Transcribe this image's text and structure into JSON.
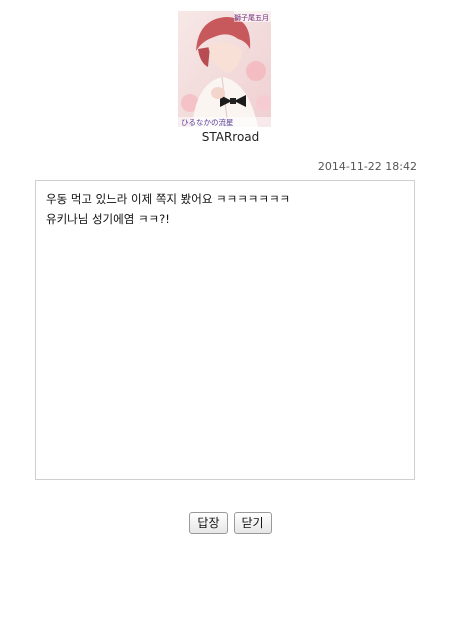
{
  "sender": {
    "name": "STARroad",
    "avatar": {
      "caption_top": "獅子尾五月",
      "caption_bottom": "ひるなかの流星"
    }
  },
  "message": {
    "timestamp": "2014-11-22 18:42",
    "body": "우동 먹고 있느라 이제 쪽지 봤어요 ㅋㅋㅋㅋㅋㅋㅋ\n유키나님 성기에염 ㅋㅋ?!"
  },
  "actions": {
    "reply_label": "답장",
    "close_label": "닫기"
  }
}
